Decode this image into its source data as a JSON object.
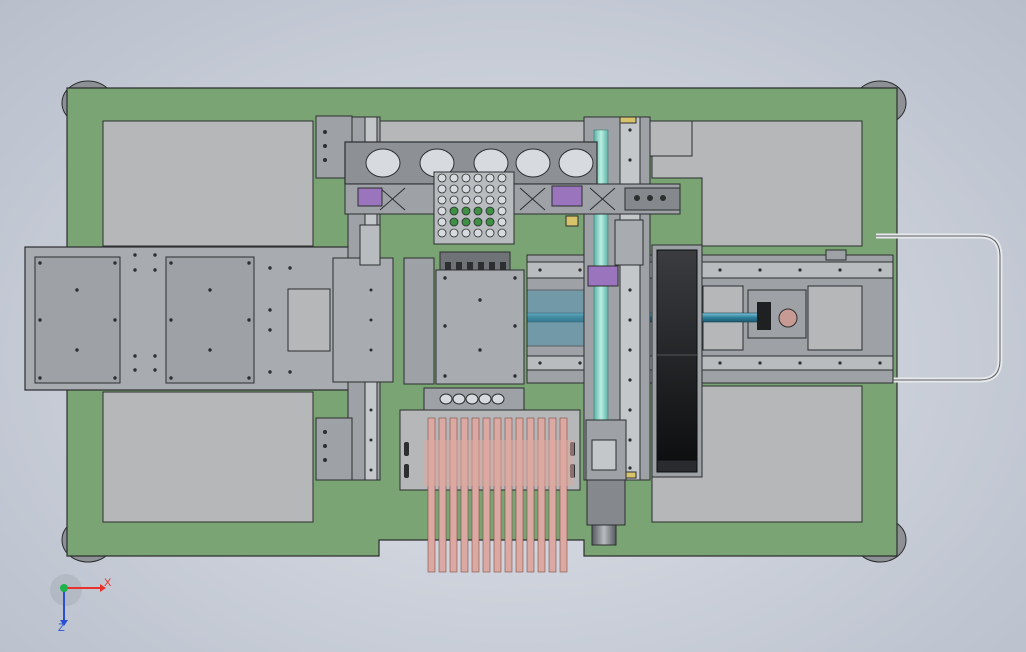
{
  "viewport": {
    "background": "#c9ced8"
  },
  "colors": {
    "base_green": "#7aa473",
    "panel_gray": "#b5b7b9",
    "metal_gray": "#9ea2a6",
    "dark_metal": "#6f7378",
    "outline": "#2c2e30",
    "blue_rod": "#2e7f9a",
    "teal_rod": "#8fd3c4",
    "purple_block": "#9a74bd",
    "pink_strip": "#dba9a1",
    "black_unit": "#1f2022",
    "yellow_sensor": "#d6c36a",
    "axis_x": "#e8302c",
    "axis_y": "#1bb34a",
    "axis_z": "#2a4fd6"
  },
  "triad": {
    "x_label": "X",
    "z_label": "Z",
    "x_icon": "x-axis-arrow-icon",
    "z_icon": "z-axis-arrow-icon",
    "y_icon": "y-axis-dot-icon"
  }
}
